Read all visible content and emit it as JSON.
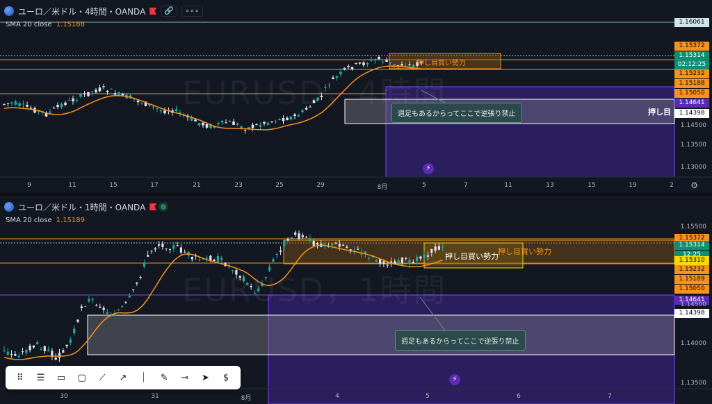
{
  "pane_top": {
    "symbol_title": "ユーロ／米ドル・4時間・OANDA",
    "indicator_label": "SMA 20 close",
    "indicator_value": "1.15188",
    "watermark": "EURUSD，4時間",
    "zone_label": "押し目買い勢力",
    "annotation": "週足もあるからってここで逆張り禁止",
    "zone_edge_label": "押し目",
    "price_labels": [
      {
        "text": "1.16061",
        "kind": "line"
      },
      {
        "text": "1.15372",
        "kind": "orange"
      },
      {
        "text": "1.15314",
        "kind": "green"
      },
      {
        "text": "02:12:25",
        "kind": "green"
      },
      {
        "text": "1.15232",
        "kind": "orange"
      },
      {
        "text": "1.15188",
        "kind": "orange"
      },
      {
        "text": "1.15050",
        "kind": "orange"
      },
      {
        "text": "1.14641",
        "kind": "purple"
      },
      {
        "text": "1.14398",
        "kind": "white"
      }
    ],
    "price_ticks": [
      "1.14500",
      "1.13500",
      "1.13000"
    ],
    "date_labels": [
      "9",
      "11",
      "15",
      "17",
      "21",
      "23",
      "25",
      "29",
      "8月",
      "5",
      "7",
      "11",
      "13",
      "15",
      "19",
      "2"
    ]
  },
  "pane_bottom": {
    "symbol_title": "ユーロ／米ドル・1時間・OANDA",
    "indicator_label": "SMA 20 close",
    "indicator_value": "1.15189",
    "watermark": "EURUSD，1時間",
    "zone_label_a": "押し目買い勢力",
    "zone_label_b": "押し目買い勢力",
    "annotation": "週足もあるからってここで逆張り禁止",
    "price_labels": [
      {
        "text": "1.15372",
        "kind": "orange"
      },
      {
        "text": "1.15314",
        "kind": "green"
      },
      {
        "text": "12:25",
        "kind": "green"
      },
      {
        "text": "1.15310",
        "kind": "yellow"
      },
      {
        "text": "1.15232",
        "kind": "orange"
      },
      {
        "text": "1.15189",
        "kind": "orange"
      },
      {
        "text": "1.15050",
        "kind": "orange"
      },
      {
        "text": "1.14641",
        "kind": "purple"
      },
      {
        "text": "1.14398",
        "kind": "white"
      }
    ],
    "price_ticks": [
      "1.15500",
      "1.14500",
      "1.14000",
      "1.13500"
    ],
    "date_labels": [
      "30",
      "31",
      "8月",
      "4",
      "5",
      "6",
      "7"
    ]
  },
  "toolbar": {
    "tools": [
      {
        "name": "drag-handle-icon"
      },
      {
        "name": "horizontal-lines-icon"
      },
      {
        "name": "callout-icon"
      },
      {
        "name": "rectangle-icon"
      },
      {
        "name": "trend-line-icon"
      },
      {
        "name": "ray-icon"
      },
      {
        "name": "vertical-line-icon"
      },
      {
        "name": "brush-icon"
      },
      {
        "name": "horizontal-ray-icon"
      },
      {
        "name": "cursor-icon"
      },
      {
        "name": "price-range-icon"
      }
    ]
  },
  "colors": {
    "bull": "#26a69a",
    "bear": "#e0e3eb",
    "sma": "#f7931a",
    "orange_label": "#f7931a",
    "green_label": "#0e8f73",
    "purple_label": "#5b2bb4",
    "zone_purple": "#2b1e5e"
  }
}
